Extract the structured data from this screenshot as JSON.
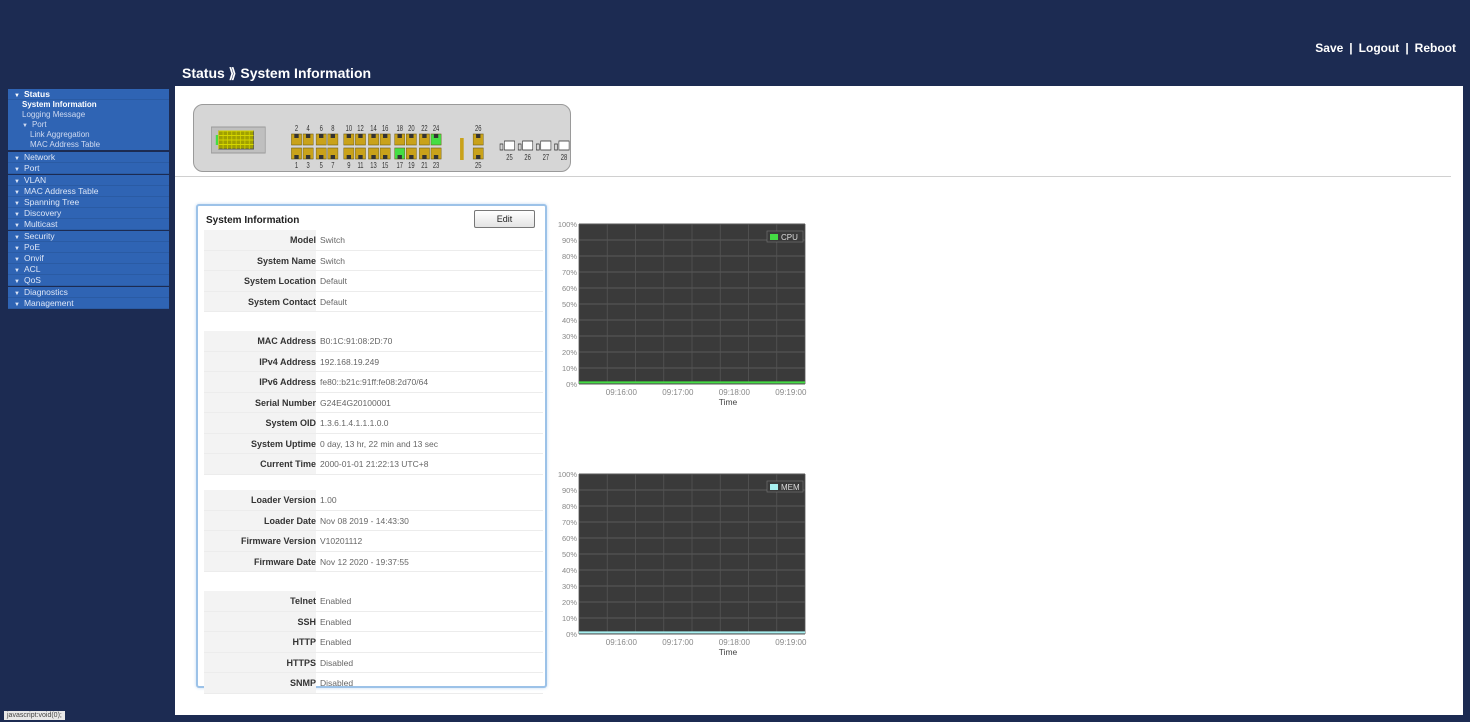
{
  "header": {
    "links": [
      "Save",
      "Logout",
      "Reboot"
    ],
    "separator": "|",
    "breadcrumb": "Status ⟫ System Information"
  },
  "sidebar": {
    "items": [
      {
        "label": "Status",
        "expanded": true,
        "children": [
          {
            "label": "System Information",
            "active": true
          },
          {
            "label": "Logging Message"
          },
          {
            "label": "Port",
            "expanded": true,
            "children": [
              {
                "label": "Link Aggregation"
              },
              {
                "label": "MAC Address Table"
              }
            ]
          }
        ]
      },
      {
        "label": "Network"
      },
      {
        "label": "Port"
      },
      {
        "label": "VLAN"
      },
      {
        "label": "MAC Address Table"
      },
      {
        "label": "Spanning Tree"
      },
      {
        "label": "Discovery"
      },
      {
        "label": "Multicast"
      },
      {
        "label": "Security"
      },
      {
        "label": "PoE"
      },
      {
        "label": "Onvif"
      },
      {
        "label": "ACL"
      },
      {
        "label": "QoS"
      },
      {
        "label": "Diagnostics"
      },
      {
        "label": "Management"
      }
    ]
  },
  "statusbar": "javascript:void(0);",
  "port_panel": {
    "top_labels": [
      "2",
      "4",
      "6",
      "8",
      "10",
      "12",
      "14",
      "16",
      "18",
      "20",
      "22",
      "24"
    ],
    "bottom_labels": [
      "1",
      "3",
      "5",
      "7",
      "9",
      "11",
      "13",
      "15",
      "17",
      "19",
      "21",
      "23"
    ],
    "uplink_top": "26",
    "uplink_bottom": "25",
    "sfp_labels": [
      "25",
      "26",
      "27",
      "28"
    ],
    "active_ports": [
      "17",
      "24"
    ],
    "colors": {
      "port_idle": "#c9a21a",
      "port_active": "#44dd44",
      "panel": "#d6d6d6"
    }
  },
  "system_info": {
    "title": "System Information",
    "edit_label": "Edit",
    "groups": [
      [
        {
          "label": "Model",
          "value": "Switch"
        },
        {
          "label": "System Name",
          "value": "Switch"
        },
        {
          "label": "System Location",
          "value": "Default"
        },
        {
          "label": "System Contact",
          "value": "Default"
        }
      ],
      [
        {
          "label": "MAC Address",
          "value": "B0:1C:91:08:2D:70"
        },
        {
          "label": "IPv4 Address",
          "value": "192.168.19.249"
        },
        {
          "label": "IPv6 Address",
          "value": "fe80::b21c:91ff:fe08:2d70/64"
        },
        {
          "label": "Serial Number",
          "value": "G24E4G20100001"
        },
        {
          "label": "System OID",
          "value": "1.3.6.1.4.1.1.1.0.0"
        },
        {
          "label": "System Uptime",
          "value": "0 day, 13 hr, 22 min and 13 sec"
        },
        {
          "label": "Current Time",
          "value": "2000-01-01 21:22:13 UTC+8"
        }
      ],
      [
        {
          "label": "Loader Version",
          "value": "1.00"
        },
        {
          "label": "Loader Date",
          "value": "Nov 08 2019 - 14:43:30"
        },
        {
          "label": "Firmware Version",
          "value": "V10201112"
        },
        {
          "label": "Firmware Date",
          "value": "Nov 12 2020 - 19:37:55"
        }
      ],
      [
        {
          "label": "Telnet",
          "value": "Enabled"
        },
        {
          "label": "SSH",
          "value": "Enabled"
        },
        {
          "label": "HTTP",
          "value": "Enabled"
        },
        {
          "label": "HTTPS",
          "value": "Disabled"
        },
        {
          "label": "SNMP",
          "value": "Disabled"
        }
      ]
    ]
  },
  "chart_data": [
    {
      "type": "line",
      "series": [
        {
          "name": "CPU",
          "values": [
            1,
            1,
            1,
            1,
            1,
            1,
            1,
            1
          ],
          "color": "#44dd44"
        }
      ],
      "x": [
        "09:15:30",
        "09:16:00",
        "09:16:30",
        "09:17:00",
        "09:17:30",
        "09:18:00",
        "09:18:30",
        "09:19:00"
      ],
      "x_ticks": [
        "09:16:00",
        "09:17:00",
        "09:18:00",
        "09:19:00"
      ],
      "y_ticks": [
        "0%",
        "10%",
        "20%",
        "30%",
        "40%",
        "50%",
        "60%",
        "70%",
        "80%",
        "90%",
        "100%"
      ],
      "xlabel": "Time",
      "ylim": [
        0,
        100
      ],
      "legend": "top-right",
      "grid": true
    },
    {
      "type": "line",
      "series": [
        {
          "name": "MEM",
          "values": [
            1,
            1,
            1,
            1,
            1,
            1,
            1,
            1
          ],
          "color": "#a8f0f0"
        }
      ],
      "x": [
        "09:15:30",
        "09:16:00",
        "09:16:30",
        "09:17:00",
        "09:17:30",
        "09:18:00",
        "09:18:30",
        "09:19:00"
      ],
      "x_ticks": [
        "09:16:00",
        "09:17:00",
        "09:18:00",
        "09:19:00"
      ],
      "y_ticks": [
        "0%",
        "10%",
        "20%",
        "30%",
        "40%",
        "50%",
        "60%",
        "70%",
        "80%",
        "90%",
        "100%"
      ],
      "xlabel": "Time",
      "ylim": [
        0,
        100
      ],
      "legend": "top-right",
      "grid": true
    }
  ]
}
